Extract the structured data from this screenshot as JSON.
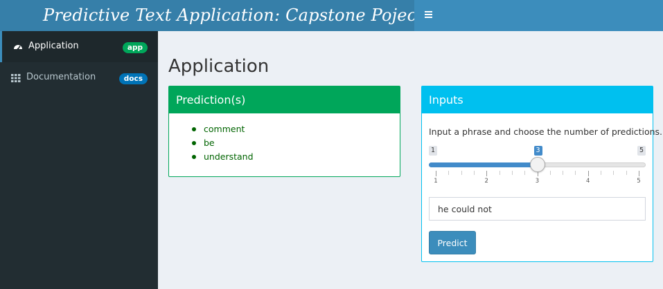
{
  "header": {
    "title": "Predictive Text Application: Capstone Poject",
    "toggle_icon": "hamburger-icon"
  },
  "sidebar": {
    "items": [
      {
        "label": "Application",
        "badge": "app",
        "badge_color": "#00a65a",
        "icon": "dashboard-icon",
        "active": true
      },
      {
        "label": "Documentation",
        "badge": "docs",
        "badge_color": "#0073b7",
        "icon": "th-grid-icon",
        "active": false
      }
    ]
  },
  "main": {
    "title": "Application",
    "predictions": {
      "title": "Prediction(s)",
      "items": [
        "comment",
        "be",
        "understand"
      ],
      "status_color": "#00a65a"
    },
    "inputs": {
      "title": "Inputs",
      "help_text": "Input a phrase and choose the number of predictions.",
      "status_color": "#00c0ef",
      "slider": {
        "min": 1,
        "max": 5,
        "value": 3,
        "min_label": "1",
        "max_label": "5",
        "value_label": "3",
        "grid_labels": [
          "1",
          "2",
          "3",
          "4",
          "5"
        ]
      },
      "phrase": {
        "value": "he could not",
        "placeholder": ""
      },
      "predict_label": "Predict"
    }
  }
}
